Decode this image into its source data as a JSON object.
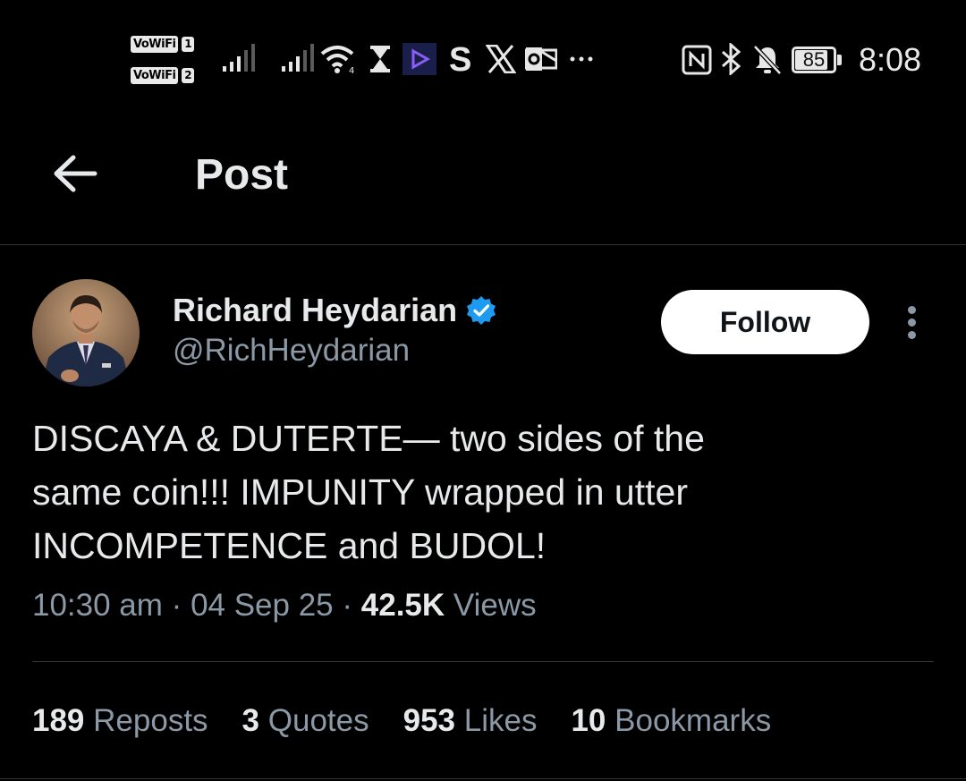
{
  "status_bar": {
    "vowifi_label": "VoWiFi",
    "sim1": "1",
    "sim2": "2",
    "battery": "85",
    "battery_level": 0.85,
    "time": "8:08",
    "icons": [
      "signal-icon",
      "wifi-icon",
      "hourglass-icon",
      "play-app-icon",
      "s-app-icon",
      "x-app-icon",
      "outlook-icon",
      "more-notifications-icon",
      "nfc-icon",
      "bluetooth-icon",
      "bell-muted-icon",
      "battery-icon"
    ]
  },
  "header": {
    "title": "Post",
    "back_icon": "arrow-left-icon"
  },
  "post": {
    "author_name": "Richard Heydarian",
    "author_handle": "@RichHeydarian",
    "verified_color": "#1d9bf0",
    "follow_label": "Follow",
    "text": "DISCAYA & DUTERTE— two sides of the\nsame coin!!! IMPUNITY wrapped in utter\nINCOMPETENCE and BUDOL!",
    "time": "10:30 am",
    "date": "04 Sep 25",
    "separator": "·",
    "views_count": "42.5K",
    "views_label": "Views"
  },
  "stats": [
    {
      "count": "189",
      "label": "Reposts"
    },
    {
      "count": "3",
      "label": "Quotes"
    },
    {
      "count": "953",
      "label": "Likes"
    },
    {
      "count": "10",
      "label": "Bookmarks"
    }
  ],
  "colors": {
    "background": "#000000",
    "text_primary": "#e7e9ea",
    "text_secondary": "#8b98a5",
    "divider": "#2f3336",
    "follow_bg": "#ffffff"
  }
}
